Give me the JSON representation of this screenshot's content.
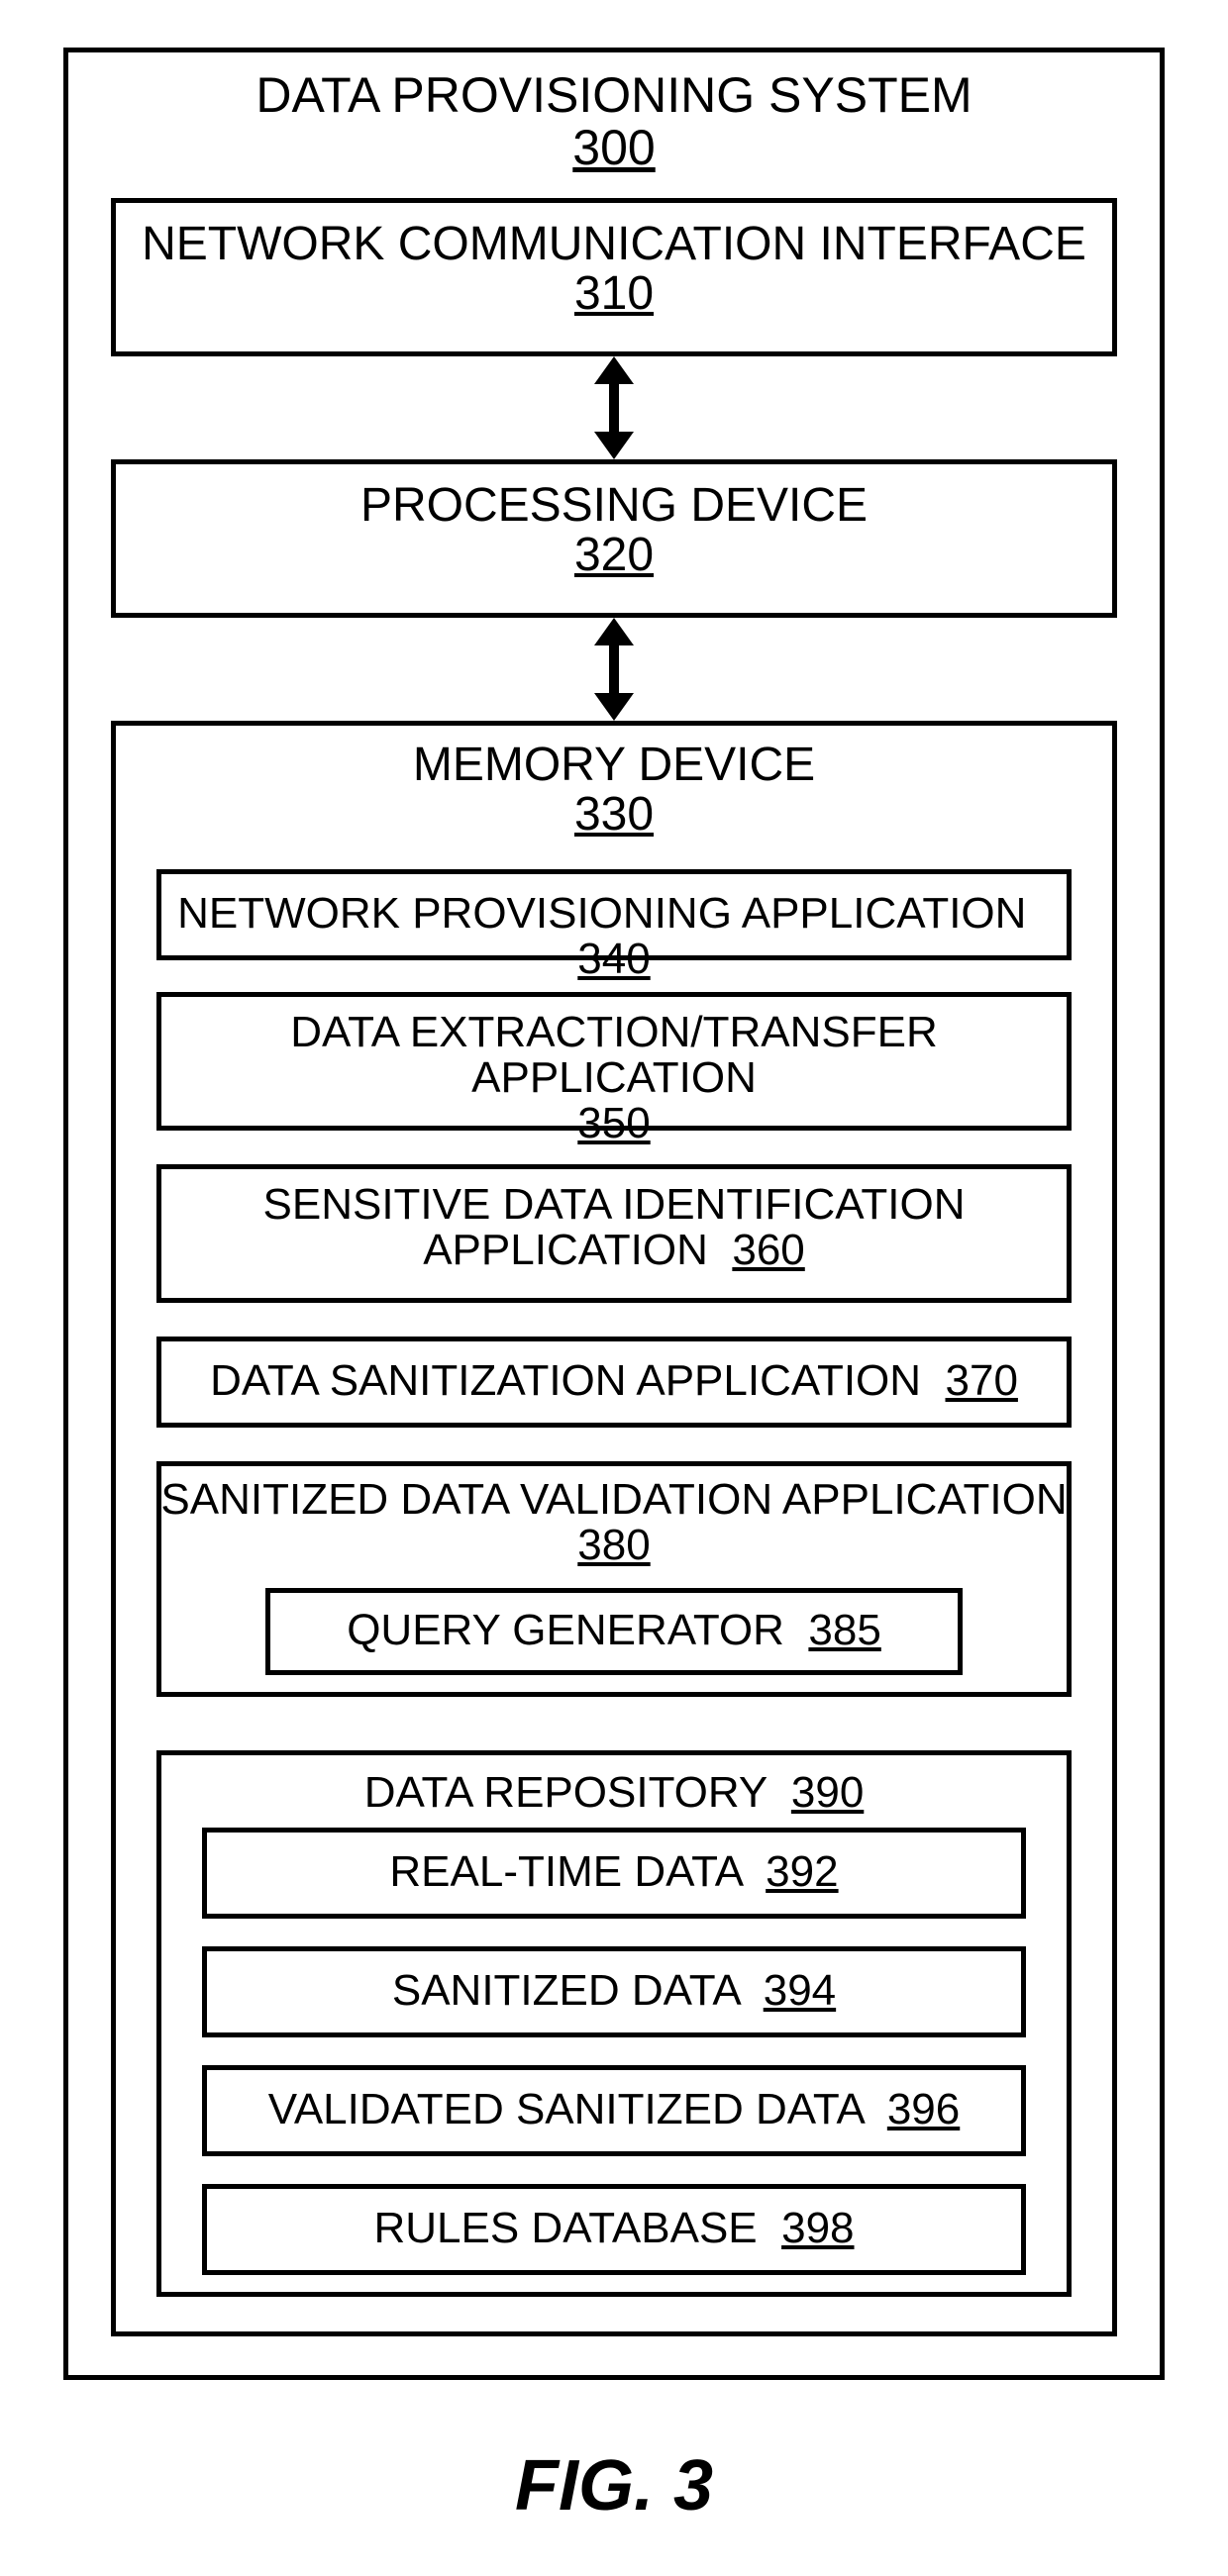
{
  "system": {
    "title": "DATA PROVISIONING SYSTEM",
    "num": "300"
  },
  "nci": {
    "title": "NETWORK COMMUNICATION INTERFACE",
    "num": "310"
  },
  "proc": {
    "title": "PROCESSING DEVICE",
    "num": "320"
  },
  "mem": {
    "title": "MEMORY DEVICE",
    "num": "330"
  },
  "npa": {
    "title": "NETWORK PROVISIONING APPLICATION",
    "num": "340"
  },
  "deta": {
    "title": "DATA EXTRACTION/TRANSFER APPLICATION",
    "num": "350"
  },
  "sdia": {
    "title1": "SENSITIVE DATA IDENTIFICATION",
    "title2": "APPLICATION",
    "num": "360"
  },
  "dsa": {
    "title": "DATA SANITIZATION APPLICATION",
    "num": "370"
  },
  "sdva": {
    "title": "SANITIZED DATA VALIDATION APPLICATION",
    "num": "380"
  },
  "qg": {
    "title": "QUERY GENERATOR",
    "num": "385"
  },
  "repo": {
    "title": "DATA REPOSITORY",
    "num": "390"
  },
  "rt": {
    "title": "REAL-TIME DATA",
    "num": "392"
  },
  "san": {
    "title": "SANITIZED DATA",
    "num": "394"
  },
  "vsd": {
    "title": "VALIDATED SANITIZED DATA",
    "num": "396"
  },
  "rdb": {
    "title": "RULES DATABASE",
    "num": "398"
  },
  "figure": "FIG. 3"
}
